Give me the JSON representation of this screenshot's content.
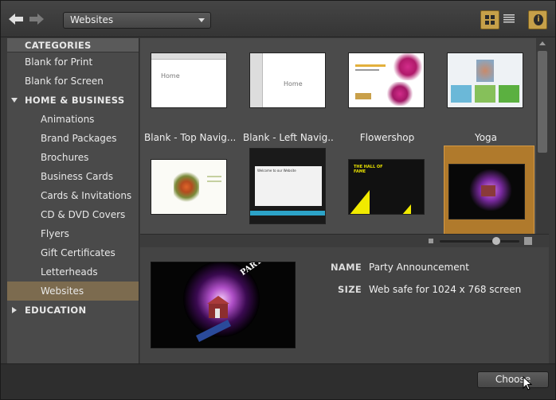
{
  "toolbar": {
    "dropdown_value": "Websites",
    "back_icon": "arrow-left-icon",
    "forward_icon": "arrow-right-icon",
    "grid_view_icon": "grid-view-icon",
    "list_view_icon": "list-view-icon",
    "info_icon": "info-icon",
    "info_glyph": "i"
  },
  "sidebar": {
    "header": "CATEGORIES",
    "items": [
      {
        "label": "Blank for Print",
        "kind": "top"
      },
      {
        "label": "Blank for Screen",
        "kind": "top"
      },
      {
        "label": "HOME & BUSINESS",
        "kind": "group",
        "expanded": true
      },
      {
        "label": "Animations",
        "kind": "sub"
      },
      {
        "label": "Brand Packages",
        "kind": "sub"
      },
      {
        "label": "Brochures",
        "kind": "sub"
      },
      {
        "label": "Business Cards",
        "kind": "sub"
      },
      {
        "label": "Cards & Invitations",
        "kind": "sub"
      },
      {
        "label": "CD & DVD Covers",
        "kind": "sub"
      },
      {
        "label": "Flyers",
        "kind": "sub"
      },
      {
        "label": "Gift Certificates",
        "kind": "sub"
      },
      {
        "label": "Letterheads",
        "kind": "sub"
      },
      {
        "label": "Websites",
        "kind": "sub",
        "selected": true
      },
      {
        "label": "EDUCATION",
        "kind": "group",
        "expanded": false
      }
    ]
  },
  "gallery": {
    "templates": [
      {
        "label": "Blank - Top Navig...",
        "thumb_text": "Home"
      },
      {
        "label": "Blank - Left Navig...",
        "thumb_text": "Home"
      },
      {
        "label": "Flowershop"
      },
      {
        "label": "Yoga"
      },
      {
        "label": ""
      },
      {
        "label": "",
        "thumb_text": "Welcome to our Website"
      },
      {
        "label": "",
        "thumb_text": "THE HALL OF FAME"
      },
      {
        "label": "",
        "selected": true
      }
    ]
  },
  "details": {
    "name_key": "NAME",
    "name_value": "Party Announcement",
    "size_key": "SIZE",
    "size_value": "Web safe for 1024 x 768 screen",
    "preview_text": "PARTY IN THE HOUSE"
  },
  "footer": {
    "choose_label": "Choose"
  },
  "colors": {
    "accent": "#c6a049",
    "selected_tile": "#b07a2c",
    "selected_row": "#7c6b4f"
  }
}
